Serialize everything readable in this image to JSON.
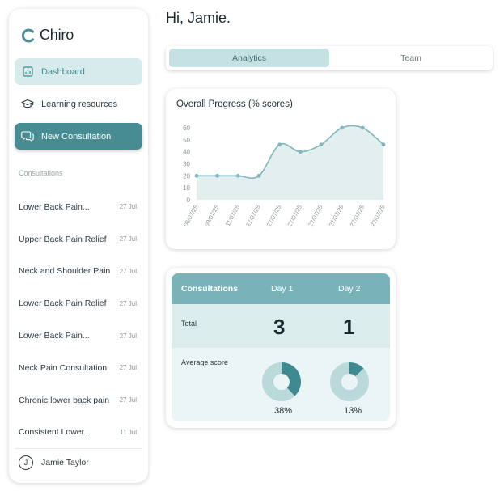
{
  "app": {
    "name": "Chiro"
  },
  "nav": {
    "dashboard": "Dashboard",
    "learning": "Learning resources",
    "new_consultation": "New Consultation"
  },
  "sidebar": {
    "section_label": "Consultations",
    "consultations": [
      {
        "title": "Lower Back Pain...",
        "date": "27 Jul"
      },
      {
        "title": "Upper Back Pain Relief",
        "date": "27 Jul"
      },
      {
        "title": "Neck and Shoulder Pain",
        "date": "27 Jul"
      },
      {
        "title": "Lower Back Pain Relief",
        "date": "27 Jul"
      },
      {
        "title": "Lower Back Pain...",
        "date": "27 Jul"
      },
      {
        "title": "Neck Pain Consultation",
        "date": "27 Jul"
      },
      {
        "title": "Chronic lower back pain",
        "date": "27 Jul"
      },
      {
        "title": "Consistent Lower...",
        "date": "11 Jul"
      }
    ],
    "user": {
      "initial": "J",
      "name": "Jamie Taylor"
    }
  },
  "greeting": "Hi, Jamie.",
  "tabs": {
    "analytics": "Analytics",
    "team": "Team",
    "active": "analytics"
  },
  "progress": {
    "title": "Overall Progress (% scores)"
  },
  "consultations_table": {
    "header": {
      "label": "Consultations",
      "day1": "Day 1",
      "day2": "Day 2"
    },
    "total": {
      "label": "Total",
      "day1": "3",
      "day2": "1"
    },
    "average": {
      "label": "Average score",
      "day1": "38%",
      "day2": "13%",
      "day1_value": 0.38,
      "day2_value": 0.13
    }
  },
  "colors": {
    "accent": "#468c92",
    "accent_light": "#d7ebec",
    "chart_line": "#7fb7bc",
    "chart_fill": "#e3eeef"
  },
  "chart_data": {
    "type": "area",
    "title": "Overall Progress (% scores)",
    "xlabel": "",
    "ylabel": "",
    "categories": [
      "06/07/25",
      "09/07/25",
      "11/07/25",
      "27/07/25",
      "27/07/25",
      "27/07/25",
      "27/07/25",
      "27/07/25",
      "27/07/25",
      "27/07/25"
    ],
    "values": [
      20,
      20,
      20,
      20,
      46,
      40,
      46,
      60,
      60,
      46
    ],
    "ylim": [
      0,
      60
    ],
    "yticks": [
      0,
      10,
      20,
      30,
      40,
      50,
      60
    ],
    "grid": false,
    "legend": "none"
  }
}
